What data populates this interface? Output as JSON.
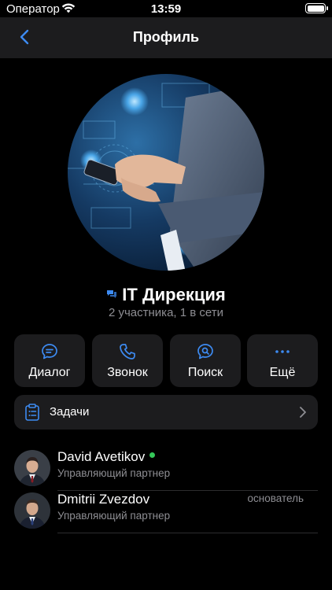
{
  "status_bar": {
    "carrier": "Оператор",
    "time": "13:59"
  },
  "nav": {
    "title": "Профиль"
  },
  "group": {
    "name": "IT Дирекция",
    "subtitle": "2 участника, 1 в сети"
  },
  "actions": [
    {
      "label": "Диалог",
      "icon": "chat-bubble-icon"
    },
    {
      "label": "Звонок",
      "icon": "phone-icon"
    },
    {
      "label": "Поиск",
      "icon": "search-bubble-icon"
    },
    {
      "label": "Ещё",
      "icon": "more-dots-icon"
    }
  ],
  "tasks": {
    "label": "Задачи",
    "icon": "clipboard-icon"
  },
  "members": [
    {
      "name": "David Avetikov",
      "role": "Управляющий партнер",
      "online": true,
      "badge": ""
    },
    {
      "name": "Dmitrii Zvezdov",
      "role": "Управляющий партнер",
      "online": false,
      "badge": "основатель"
    }
  ],
  "colors": {
    "accent": "#3d8bf2",
    "online": "#34c759",
    "card": "#1c1c1e",
    "secondary_text": "#8e8e93"
  }
}
